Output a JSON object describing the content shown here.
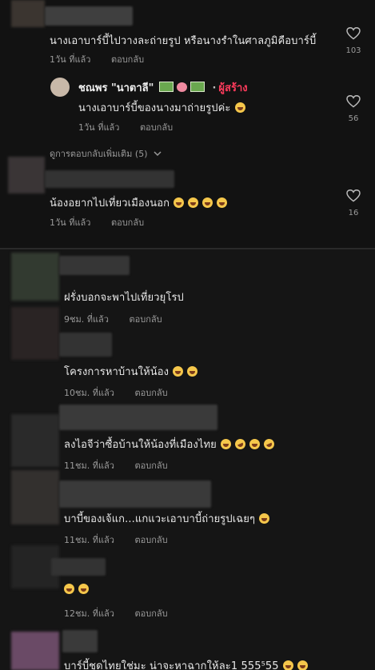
{
  "comments_top": [
    {
      "text": "นางเอาบาร์บี้ไปวางละถ่ายรูป หรือนางรำในศาลภูมิคือบาร์บี้",
      "time": "1วัน ที่แล้ว",
      "reply": "ตอบกลับ",
      "likes": "103"
    },
    {
      "author": "ชณพร \"นาตาลี\"",
      "creator_label": "ผู้สร้าง",
      "text": "นางเอาบาร์บี้ของนางมาถ่ายรูปค่ะ",
      "time": "1วัน ที่แล้ว",
      "reply": "ตอบกลับ",
      "likes": "56"
    },
    {
      "text": "น้องอยากไปเที่ยวเมืองนอก",
      "time": "1วัน ที่แล้ว",
      "reply": "ตอบกลับ",
      "likes": "16"
    }
  ],
  "view_more_replies": "ดูการตอบกลับเพิ่มเติม (5)",
  "comments_bottom": [
    {
      "text": "ฝรั่งบอกจะพาไปเที่ยวยุโรป",
      "time": "9ชม. ที่แล้ว",
      "reply": "ตอบกลับ"
    },
    {
      "text": "โครงการหาบ้านให้น้อง",
      "time": "10ชม. ที่แล้ว",
      "reply": "ตอบกลับ"
    },
    {
      "text": "ลงไอจีว่าซื้อบ้านให้น้องที่เมืองไทย",
      "time": "11ชม. ที่แล้ว",
      "reply": "ตอบกลับ"
    },
    {
      "text": "บาบี้ของเจ้แก...แกแวะเอาบาบี้ถ่ายรูปเฉยๆ",
      "time": "11ชม. ที่แล้ว",
      "reply": "ตอบกลับ"
    },
    {
      "text": "",
      "time": "12ชม. ที่แล้ว",
      "reply": "ตอบกลับ"
    },
    {
      "text": "บาร์บี้ชุดไทยใช่มะ น่าจะหาฉากให้ละ1 555⁵55"
    }
  ],
  "colors": {
    "background": "#121212",
    "text": "#e8e8e8",
    "meta": "#9a9a9a",
    "creator": "#ff3b5c",
    "emoji": "#f5c74b"
  }
}
